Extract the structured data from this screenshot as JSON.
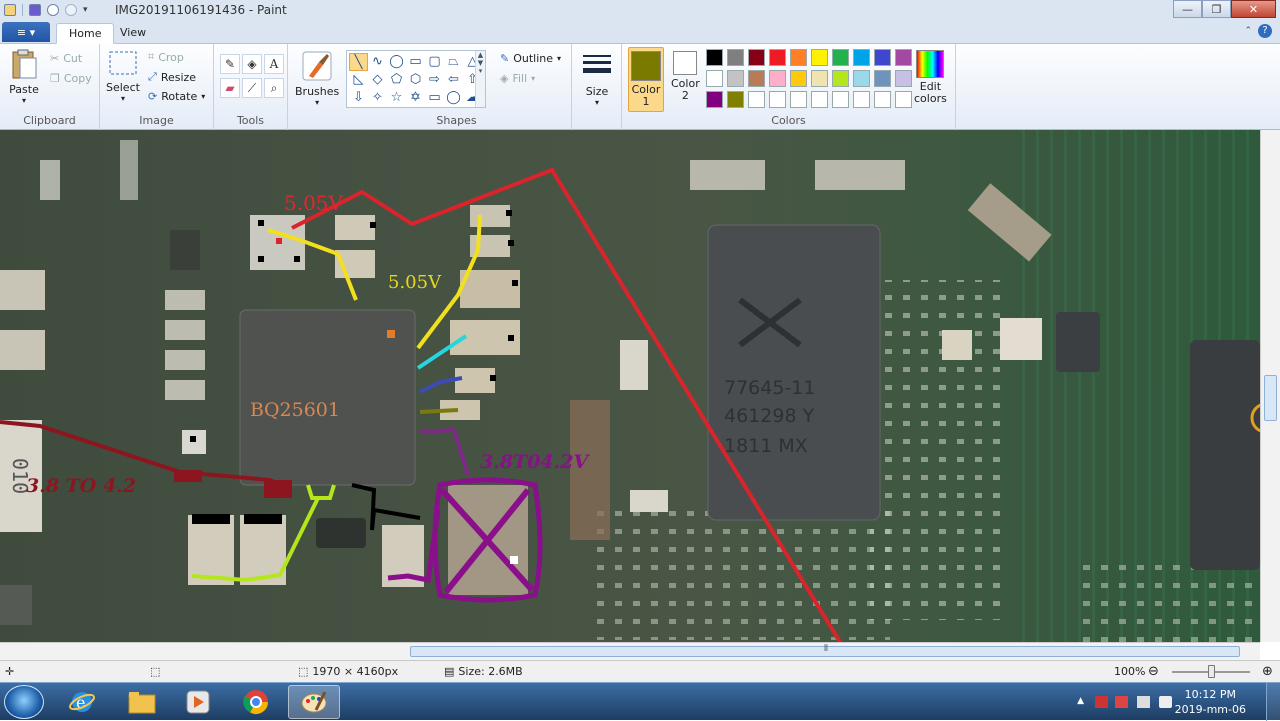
{
  "window": {
    "title": "IMG20191106191436 - Paint",
    "minimize_glyph": "—",
    "maximize_glyph": "❐",
    "close_glyph": "✕"
  },
  "tabs": {
    "file_glyph": "≡ ▾",
    "home": "Home",
    "view": "View",
    "help_glyph": "?",
    "collapse_glyph": "⌃"
  },
  "ribbon": {
    "clipboard": {
      "label": "Clipboard",
      "paste": "Paste",
      "cut": "Cut",
      "copy": "Copy"
    },
    "image": {
      "label": "Image",
      "select": "Select",
      "crop": "Crop",
      "resize": "Resize",
      "rotate": "Rotate"
    },
    "tools": {
      "label": "Tools"
    },
    "brushes": {
      "label": "Brushes"
    },
    "shapes": {
      "label": "Shapes",
      "outline": "Outline",
      "fill": "Fill"
    },
    "size": {
      "label": "Size"
    },
    "colors": {
      "label": "Colors",
      "color1_label_line1": "Color",
      "color1_label_line2": "1",
      "color2_label_line1": "Color",
      "color2_label_line2": "2",
      "edit_colors_line1": "Edit",
      "edit_colors_line2": "colors",
      "color1_value": "#7a7a00",
      "color2_value": "#ffffff",
      "palette": [
        "#000000",
        "#7f7f7f",
        "#880015",
        "#ed1c24",
        "#ff7f27",
        "#fff200",
        "#22b14c",
        "#00a2e8",
        "#3f48cc",
        "#a349a4",
        "#ffffff",
        "#c3c3c3",
        "#b97a57",
        "#ffaec9",
        "#ffc90e",
        "#efe4b0",
        "#b5e61d",
        "#99d9ea",
        "#7092be",
        "#c8bfe7",
        "#800080",
        "#808000",
        "#ffffff",
        "#ffffff",
        "#ffffff",
        "#ffffff",
        "#ffffff",
        "#ffffff",
        "#ffffff",
        "#ffffff"
      ]
    }
  },
  "annotations": {
    "volt_top_red": "5.05V",
    "volt_yellow": "5.05V",
    "ic_label": "BQ25601",
    "range_left": "3.8 TO 4.2",
    "range_purple": "3.8T04.2V",
    "chip_text_1": "77645-11",
    "chip_text_2": "461298 Y",
    "chip_text_3": "1811   MX",
    "side_component": "010"
  },
  "status": {
    "dimensions": "1970 × 4160px",
    "size": "Size: 2.6MB",
    "zoom": "100%"
  },
  "taskbar": {
    "time": "10:12 PM",
    "date": "2019-mm-06"
  }
}
